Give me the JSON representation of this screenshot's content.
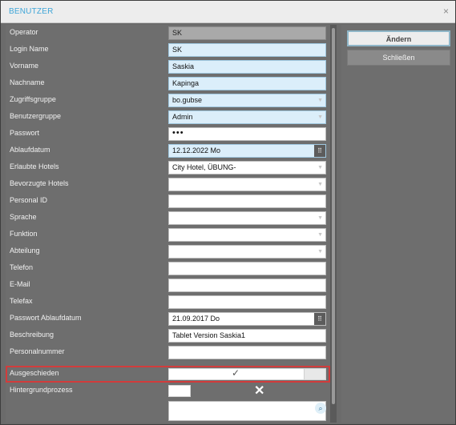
{
  "window": {
    "title": "BENUTZER",
    "close_glyph": "×"
  },
  "fields": [
    {
      "label": "Operator",
      "value": "SK"
    },
    {
      "label": "Login Name",
      "value": "SK"
    },
    {
      "label": "Vorname",
      "value": "Saskia"
    },
    {
      "label": "Nachname",
      "value": "Kapinga"
    },
    {
      "label": "Zugriffsgruppe",
      "value": "bo.gubse"
    },
    {
      "label": "Benutzergruppe",
      "value": "Admin"
    },
    {
      "label": "Passwort",
      "value": "•••"
    },
    {
      "label": "Ablaufdatum",
      "value": "12.12.2022 Mo"
    },
    {
      "label": "Erlaubte Hotels",
      "value": "City Hotel, ÜBUNG-"
    },
    {
      "label": "Bevorzugte Hotels",
      "value": ""
    },
    {
      "label": "Personal ID",
      "value": ""
    },
    {
      "label": "Sprache",
      "value": ""
    },
    {
      "label": "Funktion",
      "value": ""
    },
    {
      "label": "Abteilung",
      "value": ""
    },
    {
      "label": "Telefon",
      "value": ""
    },
    {
      "label": "E-Mail",
      "value": ""
    },
    {
      "label": "Telefax",
      "value": ""
    },
    {
      "label": "Passwort Ablaufdatum",
      "value": "21.09.2017 Do"
    },
    {
      "label": "Beschreibung",
      "value": "Tablet Version Saskia1"
    },
    {
      "label": "Personalnummer",
      "value": ""
    },
    {
      "label": "Ausgeschieden",
      "value": "✓"
    },
    {
      "label": "Hintergrundprozess",
      "value": "✕"
    }
  ],
  "actions": {
    "primary": "Ändern",
    "secondary": "Schließen"
  },
  "icons": {
    "dropdown": "chevron-down-icon",
    "calendar": "calendar-icon",
    "search": "search-icon"
  },
  "colors": {
    "accent": "#3fa6d8",
    "highlight": "#d23c3c",
    "field_blue": "#dbeefa"
  }
}
